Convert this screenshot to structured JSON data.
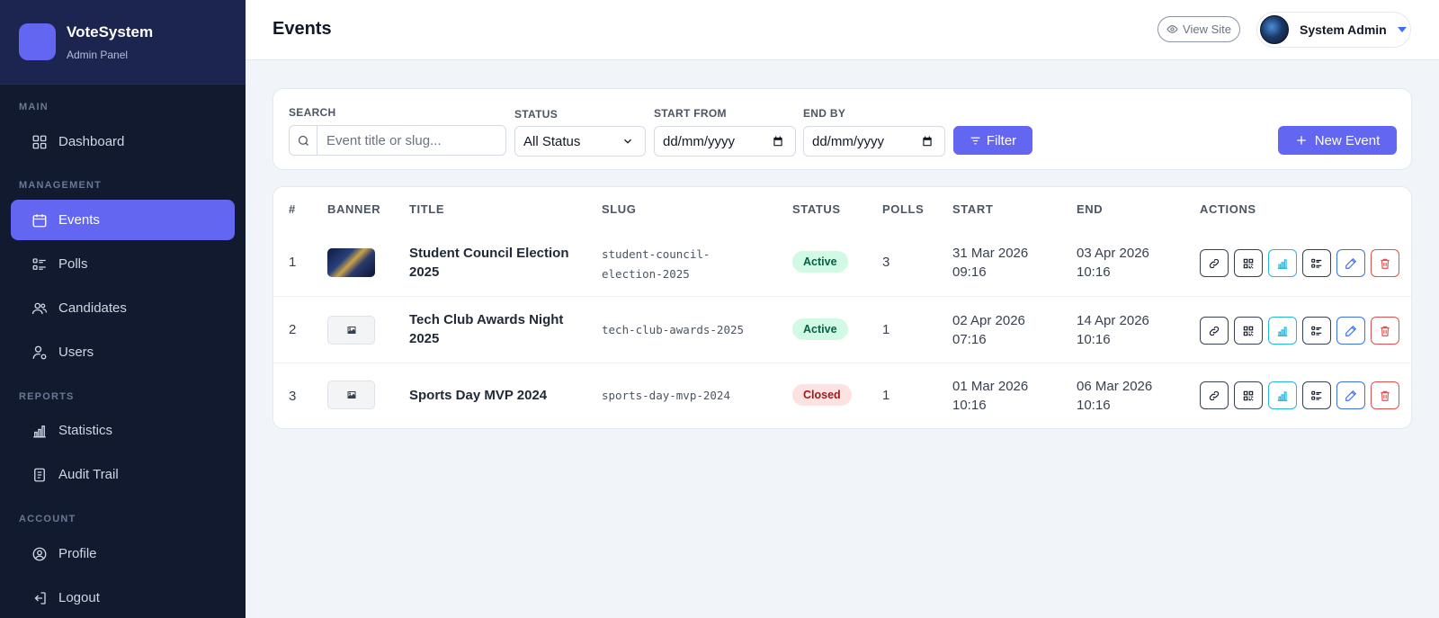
{
  "brand": {
    "name": "VoteSystem",
    "subtitle": "Admin Panel"
  },
  "sidebar": {
    "sections": [
      {
        "title": "MAIN",
        "items": [
          {
            "label": "Dashboard",
            "icon": "grid-icon"
          }
        ]
      },
      {
        "title": "MANAGEMENT",
        "items": [
          {
            "label": "Events",
            "icon": "calendar-icon",
            "active": true
          },
          {
            "label": "Polls",
            "icon": "list-icon"
          },
          {
            "label": "Candidates",
            "icon": "people-icon"
          },
          {
            "label": "Users",
            "icon": "user-gear-icon"
          }
        ]
      },
      {
        "title": "REPORTS",
        "items": [
          {
            "label": "Statistics",
            "icon": "bar-chart-icon"
          },
          {
            "label": "Audit Trail",
            "icon": "document-icon"
          }
        ]
      },
      {
        "title": "ACCOUNT",
        "items": [
          {
            "label": "Profile",
            "icon": "user-circle-icon"
          },
          {
            "label": "Logout",
            "icon": "logout-icon"
          }
        ]
      }
    ]
  },
  "header": {
    "title": "Events",
    "view_site": "View Site",
    "user_name": "System Admin"
  },
  "filters": {
    "search_label": "SEARCH",
    "search_placeholder": "Event title or slug...",
    "status_label": "STATUS",
    "status_value": "All Status",
    "start_label": "START FROM",
    "start_value": "dd/mm/yyyy",
    "end_label": "END BY",
    "end_value": "dd/mm/yyyy",
    "filter_button": "Filter",
    "new_button": "New Event"
  },
  "table": {
    "columns": [
      "#",
      "BANNER",
      "TITLE",
      "SLUG",
      "STATUS",
      "POLLS",
      "START",
      "END",
      "ACTIONS"
    ],
    "rows": [
      {
        "num": "1",
        "banner": "image",
        "title": "Student Council Election 2025",
        "slug": "student-council-election-2025",
        "status": "Active",
        "polls": "3",
        "start": "31 Mar 2026 09:16",
        "end": "03 Apr 2026 10:16"
      },
      {
        "num": "2",
        "banner": "placeholder",
        "title": "Tech Club Awards Night 2025",
        "slug": "tech-club-awards-2025",
        "status": "Active",
        "polls": "1",
        "start": "02 Apr 2026 07:16",
        "end": "14 Apr 2026 10:16"
      },
      {
        "num": "3",
        "banner": "placeholder",
        "title": "Sports Day MVP 2024",
        "slug": "sports-day-mvp-2024",
        "status": "Closed",
        "polls": "1",
        "start": "01 Mar 2026 10:16",
        "end": "06 Mar 2026 10:16"
      }
    ]
  },
  "colors": {
    "accent": "#6366f1",
    "sidebar_bg": "#111a2e",
    "brand_bg": "#1c2550",
    "active_badge": "#d1fae5",
    "closed_badge": "#fde2e2"
  }
}
